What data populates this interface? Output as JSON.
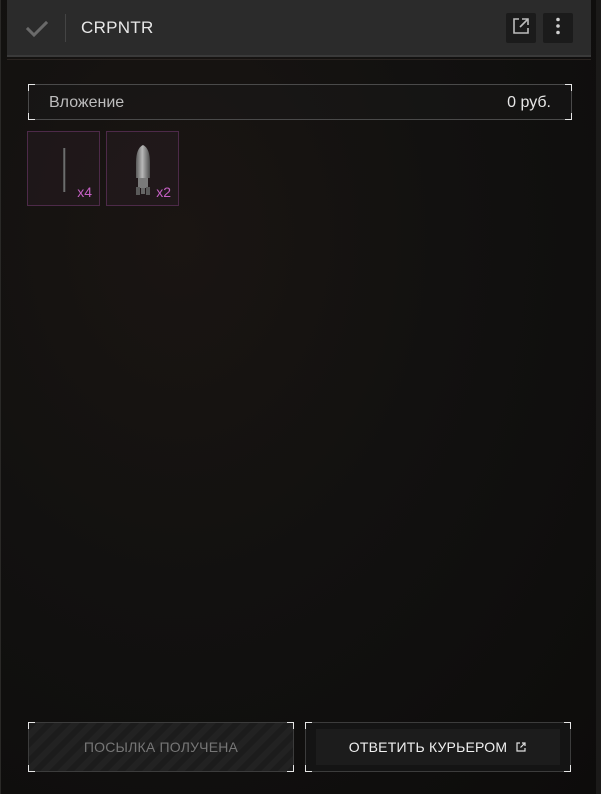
{
  "header": {
    "title": "CRPNTR",
    "icons": {
      "check": "check-icon",
      "open": "external-link-icon",
      "more": "more-vertical-icon"
    }
  },
  "attachment": {
    "label": "Вложение",
    "value": "0  руб."
  },
  "items": [
    {
      "icon": "thin-rod-item-icon",
      "qty": "x4"
    },
    {
      "icon": "shell-item-icon",
      "qty": "x2"
    }
  ],
  "buttons": {
    "received": "ПОСЫЛКА ПОЛУЧЕНА",
    "reply": "ОТВЕТИТЬ КУРЬЕРОМ"
  },
  "colors": {
    "accent_item": "#c560c4",
    "header_bg": "#2b2b2b"
  }
}
